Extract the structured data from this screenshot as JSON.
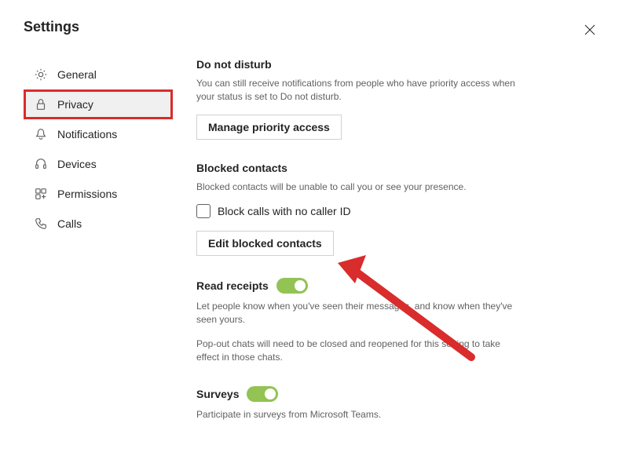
{
  "header": {
    "title": "Settings"
  },
  "sidebar": {
    "items": [
      {
        "label": "General"
      },
      {
        "label": "Privacy"
      },
      {
        "label": "Notifications"
      },
      {
        "label": "Devices"
      },
      {
        "label": "Permissions"
      },
      {
        "label": "Calls"
      }
    ]
  },
  "dnd": {
    "heading": "Do not disturb",
    "desc": "You can still receive notifications from people who have priority access when your status is set to Do not disturb.",
    "button": "Manage priority access"
  },
  "blocked": {
    "heading": "Blocked contacts",
    "desc": "Blocked contacts will be unable to call you or see your presence.",
    "checkbox_label": "Block calls with no caller ID",
    "button": "Edit blocked contacts"
  },
  "read": {
    "heading": "Read receipts",
    "desc1": "Let people know when you've seen their messages, and know when they've seen yours.",
    "desc2": "Pop-out chats will need to be closed and reopened for this setting to take effect in those chats."
  },
  "surveys": {
    "heading": "Surveys",
    "desc": "Participate in surveys from Microsoft Teams."
  }
}
